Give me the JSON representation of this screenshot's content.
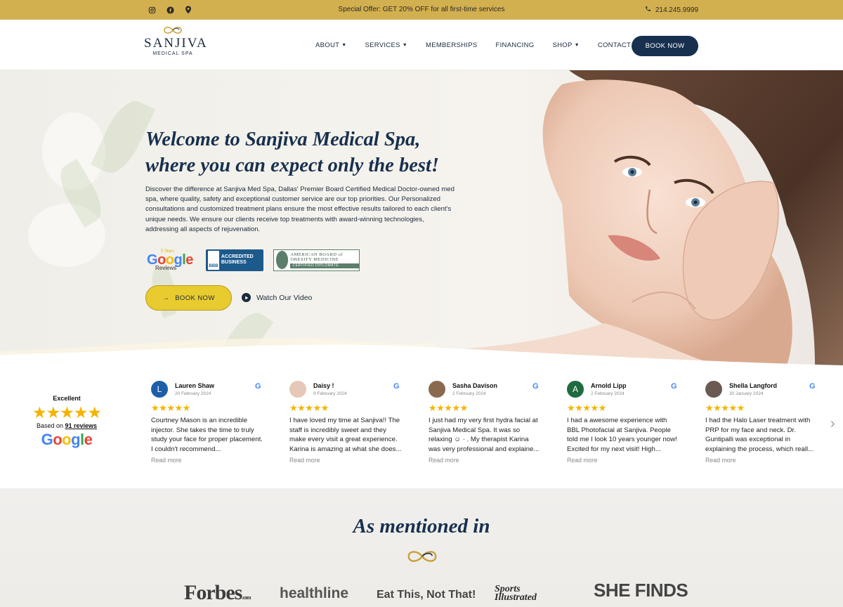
{
  "topbar": {
    "offer": "Special Offer: GET 20% OFF for all first-time services",
    "phone": "214.245.9999",
    "social_icons": [
      "instagram-icon",
      "facebook-icon",
      "location-pin-icon"
    ]
  },
  "brand": {
    "name": "SANJIVA",
    "tagline": "MEDICAL SPA"
  },
  "nav": {
    "items": [
      {
        "label": "ABOUT",
        "dropdown": true
      },
      {
        "label": "SERVICES",
        "dropdown": true
      },
      {
        "label": "MEMBERSHIPS",
        "dropdown": false
      },
      {
        "label": "FINANCING",
        "dropdown": false
      },
      {
        "label": "SHOP",
        "dropdown": true
      },
      {
        "label": "CONTACT",
        "dropdown": false
      }
    ],
    "book_label": "BOOK NOW"
  },
  "hero": {
    "title": "Welcome to Sanjiva Medical Spa, where you can expect only the best!",
    "description": "Discover the difference at Sanjiva Med Spa, Dallas' Premier Board Certified Medical Doctor-owned med spa, where quality, safety and exceptional customer service are our top priorities. Our Personalized consultations and customized treatment plans ensure the most effective results tailored to each client's unique needs. We ensure our clients receive top treatments with award-winning technologies, addressing all aspects of rejuvenation.",
    "badges": {
      "google_stars_caption": "5 Stars",
      "google_word": "Google",
      "google_reviews": "Reviews",
      "bbb_seal": "BBB",
      "bbb_text": "ACCREDITED BUSINESS",
      "board_text": "AMERICAN BOARD of OBESITY MEDICINE",
      "board_diploma": "CERTIFIED DIPLOMATE"
    },
    "cta_label": "BOOK NOW",
    "video_label": "Watch Our Video"
  },
  "reviews": {
    "summary": {
      "rating_label": "Excellent",
      "stars": "★★★★★",
      "based_on_prefix": "Based on ",
      "based_on_count": "91 reviews",
      "source": "Google"
    },
    "items": [
      {
        "name": "Lauren Shaw",
        "date": "20 February 2024",
        "initial": "L",
        "avatar_color": "#1d5fa8",
        "stars": "★★★★★",
        "text": "Courtney Mason is an incredible injector. She takes the time to truly study your face for proper placement. I couldn't recommend...",
        "read_more": "Read more"
      },
      {
        "name": "Daisy !",
        "date": "9 February 2024",
        "initial": "",
        "avatar_color": "#e5c8b8",
        "stars": "★★★★★",
        "text": "I have loved my time at Sanjiva!! The staff is incredibly sweet and they make every visit a great experience. Karina is amazing at what she does...",
        "read_more": "Read more"
      },
      {
        "name": "Sasha Davison",
        "date": "2 February 2024",
        "initial": "",
        "avatar_color": "#8a6a4f",
        "stars": "★★★★★",
        "text": "I just had my very first hydra facial at Sanjiva Medical Spa. It was so relaxing ☺ · . My therapist Karina was very professional and explaine...",
        "read_more": "Read more"
      },
      {
        "name": "Arnold Lipp",
        "date": "2 February 2024",
        "initial": "A",
        "avatar_color": "#1e6b3f",
        "stars": "★★★★★",
        "text": "I had a awesome experience with BBL Photofacial at Sanjiva. People told me I look 10 years younger now! Excited for my next visit! High...",
        "read_more": "Read more"
      },
      {
        "name": "Shella Langford",
        "date": "30 January 2024",
        "initial": "",
        "avatar_color": "#6b5a52",
        "stars": "★★★★★",
        "text": "I had the Halo Laser treatment with PRP for my face and neck. Dr. Guntipalli was exceptional in explaining the process, which reall...",
        "read_more": "Read more"
      }
    ]
  },
  "mentioned": {
    "title": "As mentioned in",
    "publications": [
      "Forbes",
      "healthline",
      "Eat This, Not That!",
      "Sports Illustrated",
      "SHE FINDS"
    ],
    "forbes_suffix": ".com"
  },
  "colors": {
    "gold": "#d3b04f",
    "navy": "#17304f",
    "cta_yellow": "#e8cc2f",
    "star": "#f4b400"
  }
}
